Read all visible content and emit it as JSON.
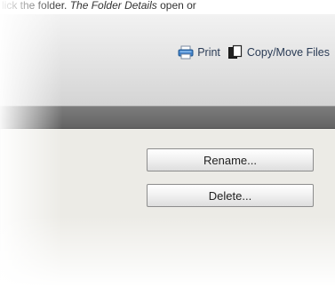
{
  "caption": {
    "prefix": "lick the folder. ",
    "italic_text": "The Folder Details",
    "suffix": " open or"
  },
  "toolbar": {
    "print_label": "Print",
    "print_icon": "printer-icon",
    "copy_move_label": "Copy/Move Files",
    "copy_move_icon": "copy-files-icon"
  },
  "panel": {
    "rename_label": "Rename...",
    "delete_label": "Delete..."
  },
  "colors": {
    "toolbar_text": "#2a3b55",
    "header_band": "#6e6e6e",
    "panel_bg": "#ecebe6"
  }
}
